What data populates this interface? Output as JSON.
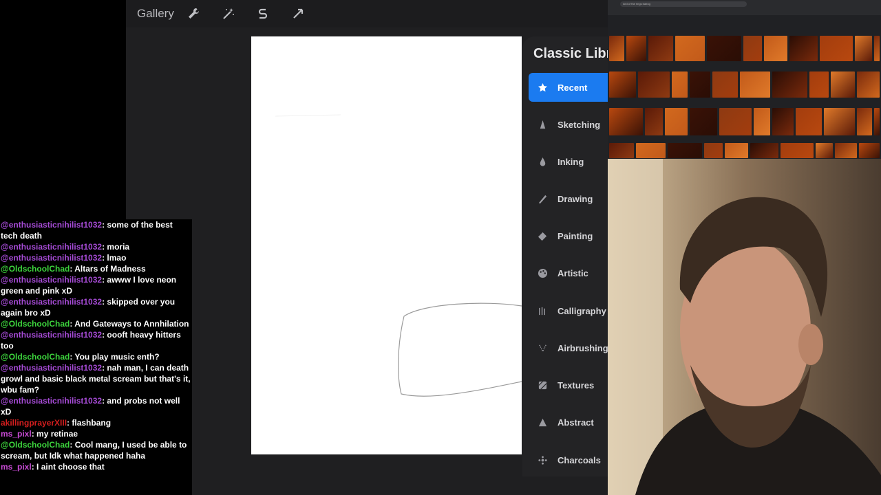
{
  "toolbar": {
    "gallery_label": "Gallery",
    "icons": [
      "wrench-icon",
      "magic-wand-icon",
      "selection-s-icon",
      "arrow-cursor-icon"
    ]
  },
  "brush_library": {
    "title": "Classic Libr",
    "categories": [
      {
        "label": "Recent",
        "icon": "star-icon",
        "active": true
      },
      {
        "label": "Sketching",
        "icon": "pencil-tip-icon",
        "active": false
      },
      {
        "label": "Inking",
        "icon": "ink-drop-icon",
        "active": false
      },
      {
        "label": "Drawing",
        "icon": "drawing-stroke-icon",
        "active": false
      },
      {
        "label": "Painting",
        "icon": "paint-brush-icon",
        "active": false
      },
      {
        "label": "Artistic",
        "icon": "palette-icon",
        "active": false
      },
      {
        "label": "Calligraphy",
        "icon": "calligraphy-icon",
        "active": false
      },
      {
        "label": "Airbrushing",
        "icon": "airbrush-icon",
        "active": false
      },
      {
        "label": "Textures",
        "icon": "texture-icon",
        "active": false
      },
      {
        "label": "Abstract",
        "icon": "triangle-icon",
        "active": false
      },
      {
        "label": "Charcoals",
        "icon": "charcoal-icon",
        "active": false
      }
    ]
  },
  "chat": {
    "colors": {
      "purple": "#a64bd6",
      "green": "#3dd63d",
      "red": "#d41e1e",
      "pink": "#c94bd6"
    },
    "messages": [
      {
        "user": "@enthusiasticnihilist1032",
        "color": "purple",
        "text": ": some of the best tech death"
      },
      {
        "user": "@enthusiasticnihilist1032",
        "color": "purple",
        "text": ": moria"
      },
      {
        "user": "@enthusiasticnihilist1032",
        "color": "purple",
        "text": ": lmao"
      },
      {
        "user": "@OldschoolChad",
        "color": "green",
        "text": ": Altars of Madness"
      },
      {
        "user": "@enthusiasticnihilist1032",
        "color": "purple",
        "text": ": awww I love neon green and pink xD"
      },
      {
        "user": "@enthusiasticnihilist1032",
        "color": "purple",
        "text": ": skipped over you again bro xD"
      },
      {
        "user": "@OldschoolChad",
        "color": "green",
        "text": ": And Gateways to Annhilation"
      },
      {
        "user": "@enthusiasticnihilist1032",
        "color": "purple",
        "text": ": oooft heavy hitters too"
      },
      {
        "user": "@OldschoolChad",
        "color": "green",
        "text": ": You play music enth?"
      },
      {
        "user": "@enthusiasticnihilist1032",
        "color": "purple",
        "text": ": nah man, I can death growl and basic black metal scream but that's it, wbu fam?"
      },
      {
        "user": "@enthusiasticnihilist1032",
        "color": "purple",
        "text": ": and probs not well xD"
      },
      {
        "user": "akillingprayerXIII",
        "color": "red",
        "text": ": flashbang"
      },
      {
        "user": "ms_pixl",
        "color": "pink",
        "text": ": my retinae"
      },
      {
        "user": "@OldschoolChad",
        "color": "green",
        "text": ": Cool mang, I used be able to scream, but Idk what happened haha"
      },
      {
        "user": "ms_pixl",
        "color": "pink",
        "text": ": I aint choose that"
      }
    ]
  },
  "reference": {
    "search_text": "lord of the rings balrog"
  }
}
